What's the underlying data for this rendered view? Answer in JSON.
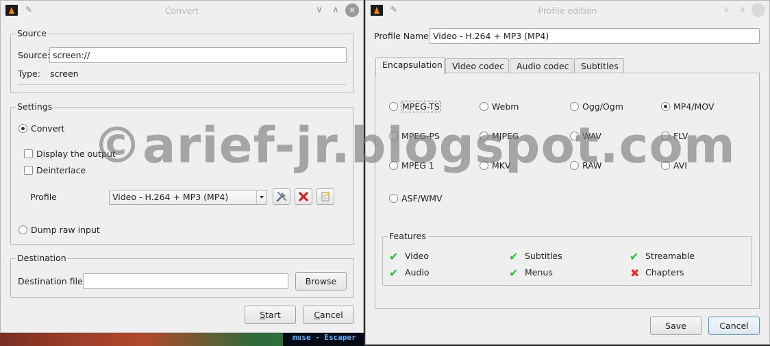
{
  "convert": {
    "title": "Convert",
    "source_group": "Source",
    "source_label": "Source:",
    "source_value": "screen://",
    "type_label": "Type:",
    "type_value": "screen",
    "settings_group": "Settings",
    "convert_radio": "Convert",
    "display_output": "Display the output",
    "deinterlace": "Deinterlace",
    "profile_label": "Profile",
    "profile_value": "Video - H.264 + MP3 (MP4)",
    "dump_raw": "Dump raw input",
    "destination_group": "Destination",
    "destination_label": "Destination file:",
    "destination_value": "",
    "browse": "Browse",
    "start_u": "S",
    "start_rest": "tart",
    "cancel_u": "C",
    "cancel_rest": "ancel",
    "icons": [
      "vlc-cone-icon",
      "pin-icon",
      "minimize-icon",
      "maximize-icon",
      "close-icon",
      "edit-profile-icon",
      "delete-profile-icon",
      "new-profile-icon"
    ]
  },
  "profile": {
    "title": "Profile edition",
    "name_label": "Profile Name",
    "name_value": "Video - H.264 + MP3 (MP4)",
    "tabs": [
      "Encapsulation",
      "Video codec",
      "Audio codec",
      "Subtitles"
    ],
    "formats": [
      "MPEG-TS",
      "Webm",
      "Ogg/Ogm",
      "MP4/MOV",
      "MPEG-PS",
      "MJPEG",
      "WAV",
      "FLV",
      "MPEG 1",
      "MKV",
      "RAW",
      "AVI",
      "ASF/WMV"
    ],
    "selected_format": "MP4/MOV",
    "features_group": "Features",
    "features": [
      "Video",
      "Subtitles",
      "Streamable",
      "Audio",
      "Menus",
      "Chapters"
    ],
    "save": "Save",
    "cancel": "Cancel"
  },
  "terminal": {
    "text": "muse - Escaper"
  },
  "watermark": "©arief-jr.blogspot.com",
  "colors": {
    "check": "#2bb83a",
    "cross": "#e0302a",
    "vlc_orange": "#f08a00"
  }
}
